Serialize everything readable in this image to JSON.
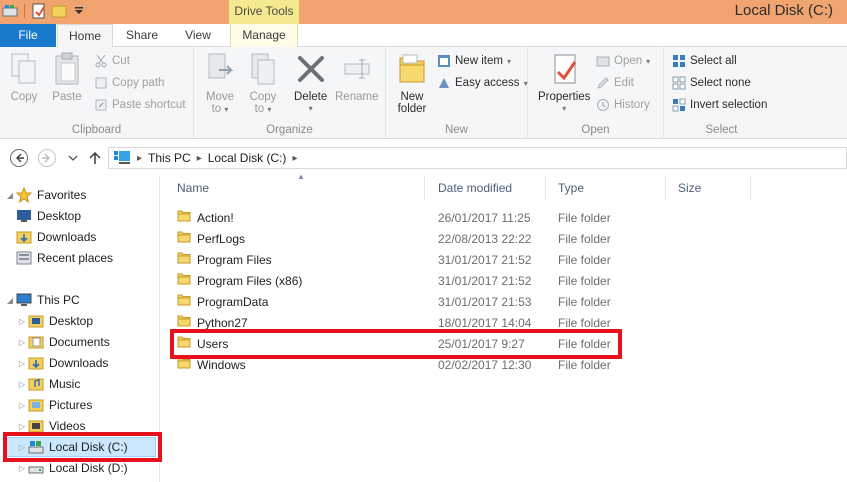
{
  "window": {
    "title": "Local Disk (C:)",
    "contextual_tab_group": "Drive Tools"
  },
  "tabs": {
    "file": "File",
    "home": "Home",
    "share": "Share",
    "view": "View",
    "manage": "Manage"
  },
  "ribbon": {
    "clipboard": {
      "label": "Clipboard",
      "copy": "Copy",
      "paste": "Paste",
      "cut": "Cut",
      "copy_path": "Copy path",
      "paste_shortcut": "Paste shortcut"
    },
    "organize": {
      "label": "Organize",
      "move_to_1": "Move",
      "move_to_2": "to",
      "copy_to_1": "Copy",
      "copy_to_2": "to",
      "delete": "Delete",
      "rename": "Rename"
    },
    "new": {
      "label": "New",
      "new_folder_1": "New",
      "new_folder_2": "folder",
      "new_item": "New item",
      "easy_access": "Easy access"
    },
    "open": {
      "label": "Open",
      "properties": "Properties",
      "open": "Open",
      "edit": "Edit",
      "history": "History"
    },
    "select": {
      "label": "Select",
      "select_all": "Select all",
      "select_none": "Select none",
      "invert_selection": "Invert selection"
    }
  },
  "address": {
    "crumbs": [
      "This PC",
      "Local Disk (C:)"
    ]
  },
  "navpane": {
    "favorites": "Favorites",
    "fav_items": [
      "Desktop",
      "Downloads",
      "Recent places"
    ],
    "this_pc": "This PC",
    "pc_items": [
      "Desktop",
      "Documents",
      "Downloads",
      "Music",
      "Pictures",
      "Videos",
      "Local Disk (C:)",
      "Local Disk (D:)"
    ]
  },
  "filelist": {
    "columns": {
      "name": "Name",
      "date": "Date modified",
      "type": "Type",
      "size": "Size"
    },
    "rows": [
      {
        "name": "Action!",
        "date": "26/01/2017 11:25",
        "type": "File folder"
      },
      {
        "name": "PerfLogs",
        "date": "22/08/2013 22:22",
        "type": "File folder"
      },
      {
        "name": "Program Files",
        "date": "31/01/2017 21:52",
        "type": "File folder"
      },
      {
        "name": "Program Files (x86)",
        "date": "31/01/2017 21:52",
        "type": "File folder"
      },
      {
        "name": "ProgramData",
        "date": "31/01/2017 21:53",
        "type": "File folder"
      },
      {
        "name": "Python27",
        "date": "18/01/2017 14:04",
        "type": "File folder"
      },
      {
        "name": "Users",
        "date": "25/01/2017 9:27",
        "type": "File folder"
      },
      {
        "name": "Windows",
        "date": "02/02/2017 12:30",
        "type": "File folder"
      }
    ]
  },
  "colors": {
    "titlebar": "#f0a470",
    "file_tab": "#1979ca",
    "highlight": "#e8101a",
    "selected": "#cce8ff"
  }
}
